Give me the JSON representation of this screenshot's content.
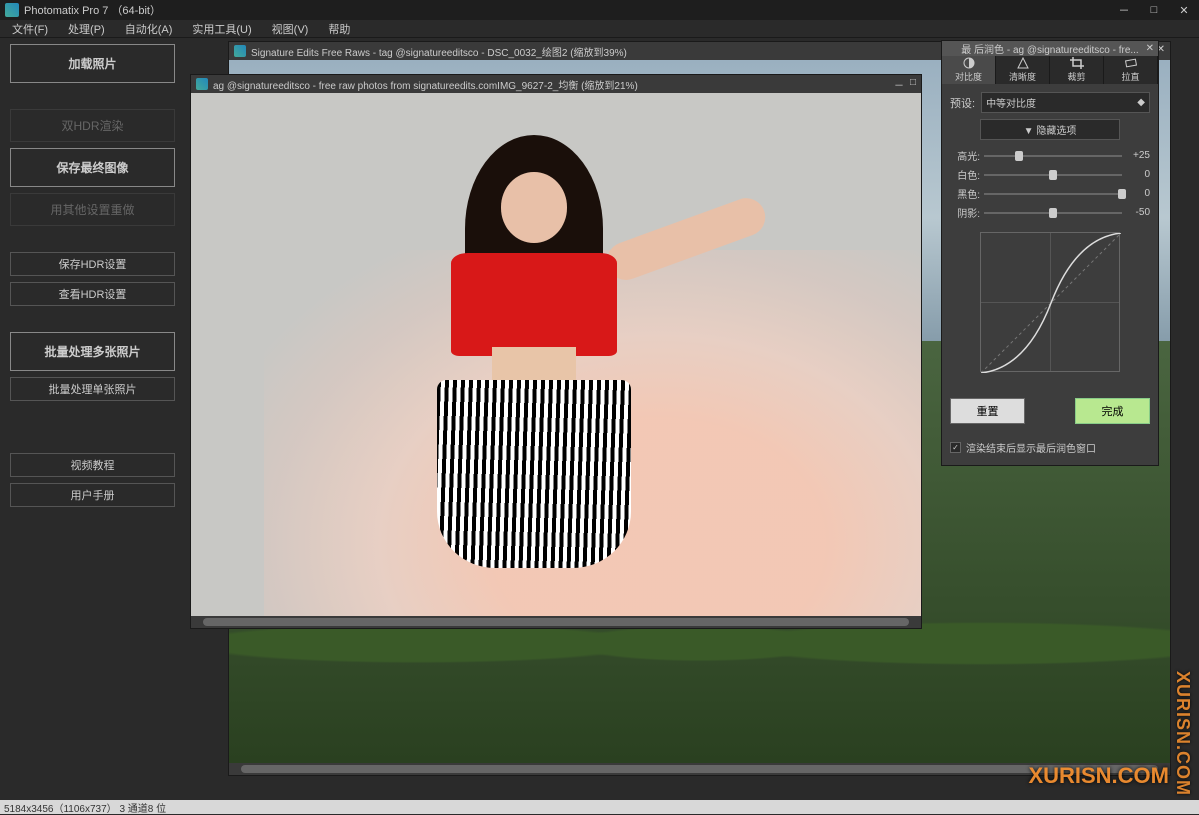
{
  "app": {
    "title": "Photomatix Pro 7 （64-bit）"
  },
  "menu": [
    "文件(F)",
    "处理(P)",
    "自动化(A)",
    "实用工具(U)",
    "视图(V)",
    "帮助"
  ],
  "sidebar": {
    "load": "加载照片",
    "dualhdr": "双HDR渲染",
    "savefinal": "保存最终图像",
    "reprocess": "用其他设置重做",
    "savehdr": "保存HDR设置",
    "viewhdr": "查看HDR设置",
    "batchmulti": "批量处理多张照片",
    "batchsingle": "批量处理单张照片",
    "video": "视频教程",
    "manual": "用户手册"
  },
  "doc1": {
    "title": "Signature Edits Free Raws - tag @signatureeditsco - DSC_0032_绘图2 (缩放到39%)"
  },
  "doc2": {
    "title": "ag @signatureeditsco - free raw photos from signatureedits.comIMG_9627-2_均衡 (缩放到21%)"
  },
  "panel": {
    "title": "最 后润色 - ag @signatureeditsco - fre...",
    "tabs": [
      "对比度",
      "清晰度",
      "裁剪",
      "拉直"
    ],
    "preset_label": "预设:",
    "preset_value": "中等对比度",
    "hide_opts": "▼ 隐藏选项",
    "sliders": [
      {
        "label": "高光:",
        "value": "+25",
        "pos": 25
      },
      {
        "label": "白色:",
        "value": "0",
        "pos": 50
      },
      {
        "label": "黑色:",
        "value": "0",
        "pos": 100
      },
      {
        "label": "阴影:",
        "value": "-50",
        "pos": 50
      }
    ],
    "reset": "重置",
    "done": "完成",
    "checkbox": "渲染结束后显示最后润色窗口",
    "checked": true
  },
  "status": "5184x3456（1106x737） 3 通道8 位",
  "watermark": "XURISN.COM"
}
